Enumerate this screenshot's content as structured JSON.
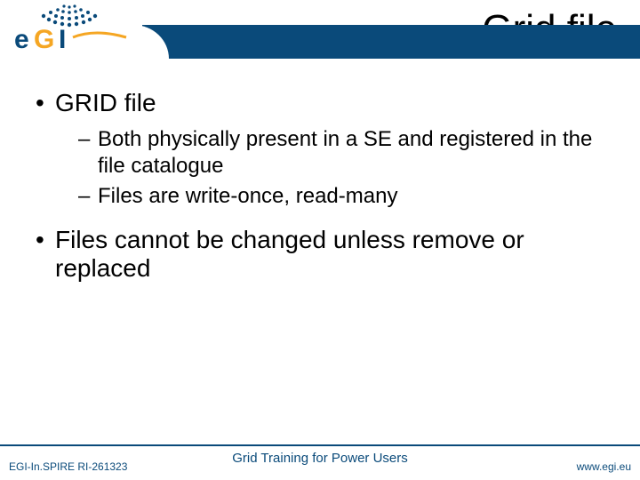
{
  "header": {
    "title": "Grid file"
  },
  "content": {
    "bullets": [
      {
        "level": 1,
        "text": "GRID file"
      },
      {
        "level": 2,
        "text": "Both physically present in a SE and registered in the file catalogue"
      },
      {
        "level": 2,
        "text": " Files are write-once, read-many"
      },
      {
        "level": 1,
        "text": "Files cannot be changed unless remove or replaced"
      }
    ]
  },
  "footer": {
    "left": "EGI-In.SPIRE RI-261323",
    "center": "Grid Training for Power Users",
    "right": "www.egi.eu"
  }
}
